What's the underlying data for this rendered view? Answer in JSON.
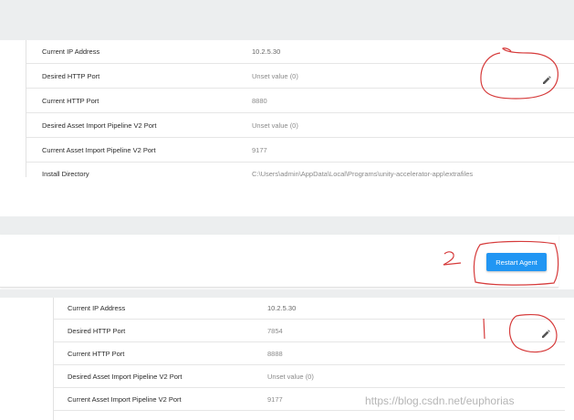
{
  "section1": {
    "rows": [
      {
        "label": "Current IP Address",
        "value": "10.2.5.30"
      },
      {
        "label": "Desired HTTP Port",
        "value": "Unset value (0)"
      },
      {
        "label": "Current HTTP Port",
        "value": "8880"
      },
      {
        "label": "Desired Asset Import Pipeline V2 Port",
        "value": "Unset value (0)"
      },
      {
        "label": "Current Asset Import Pipeline V2 Port",
        "value": "9177"
      },
      {
        "label": "Install Directory",
        "value": "C:\\Users\\admin\\AppData\\Local\\Programs\\unity-accelerator-app\\extrafiles"
      }
    ]
  },
  "toolbar": {
    "restart_label": "Restart Agent"
  },
  "section2": {
    "rows": [
      {
        "label": "Current IP Address",
        "value": "10.2.5.30"
      },
      {
        "label": "Desired HTTP Port",
        "value": "7854"
      },
      {
        "label": "Current HTTP Port",
        "value": "8888"
      },
      {
        "label": "Desired Asset Import Pipeline V2 Port",
        "value": "Unset value (0)"
      },
      {
        "label": "Current Asset Import Pipeline V2 Port",
        "value": "9177"
      }
    ]
  },
  "annotations": {
    "marker_2": "2",
    "marker_1": "1",
    "color": "#d63b3b"
  },
  "watermark": "https://blog.csdn.net/euphorias",
  "icons": {
    "edit": "pencil-icon"
  }
}
